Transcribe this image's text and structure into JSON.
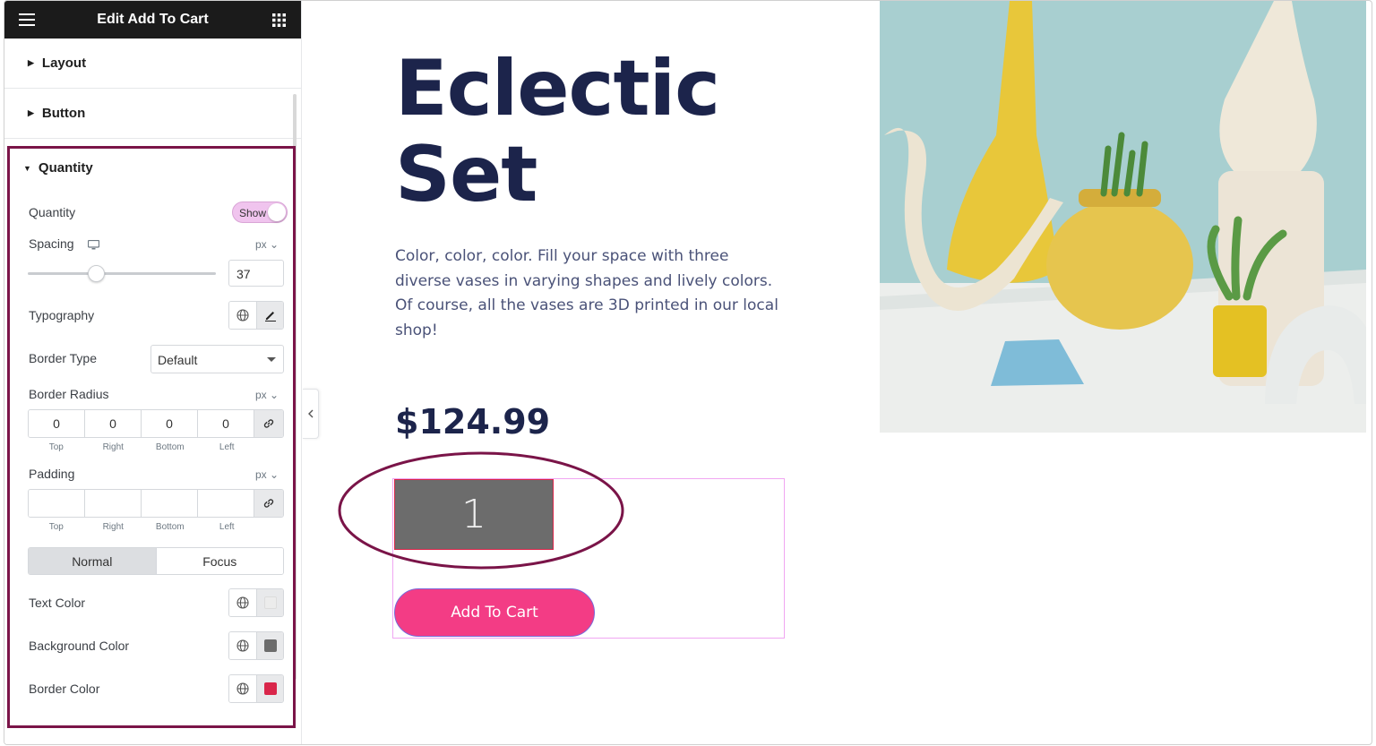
{
  "sidebar": {
    "title": "Edit Add To Cart",
    "sections": {
      "layout": "Layout",
      "button": "Button",
      "quantity": "Quantity"
    },
    "quantity": {
      "show_label": "Quantity",
      "toggle_label": "Show",
      "spacing_label": "Spacing",
      "spacing_unit": "px",
      "spacing_value": "37",
      "typography_label": "Typography",
      "border_type_label": "Border Type",
      "border_type_value": "Default",
      "border_radius_label": "Border Radius",
      "border_radius_unit": "px",
      "border_radius_values": [
        "0",
        "0",
        "0",
        "0"
      ],
      "dim_labels": [
        "Top",
        "Right",
        "Bottom",
        "Left"
      ],
      "padding_label": "Padding",
      "padding_unit": "px",
      "tabs": [
        "Normal",
        "Focus"
      ],
      "text_color_label": "Text Color",
      "background_color_label": "Background Color",
      "border_color_label": "Border Color",
      "text_color": "#ececec",
      "background_color": "#6c6c6c",
      "border_color": "#d9264a"
    }
  },
  "preview": {
    "title_line1": "Eclectic",
    "title_line2": "Set",
    "description": "Color, color, color. Fill your space with three diverse vases in varying shapes and lively colors. Of course, all the vases are 3D printed in our local shop!",
    "price": "$124.99",
    "quantity": "1",
    "add_to_cart": "Add To Cart"
  },
  "colors": {
    "accent_button": "#f33c85",
    "highlight_frame": "#7a1448",
    "heading": "#1c244b"
  }
}
